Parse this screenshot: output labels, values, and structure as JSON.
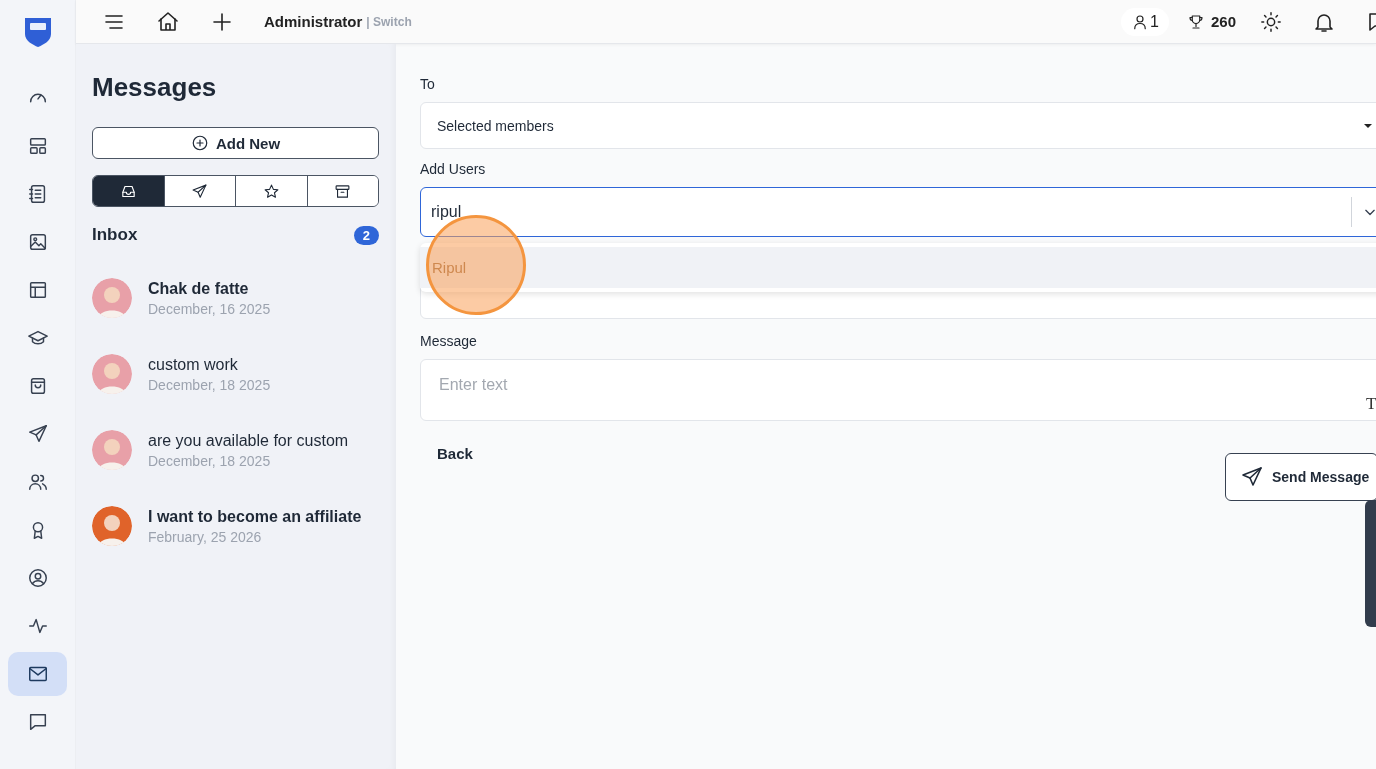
{
  "rail": {
    "items": [
      {
        "kind": "gauge",
        "selected": false
      },
      {
        "kind": "layout",
        "selected": false
      },
      {
        "kind": "notebook",
        "selected": false
      },
      {
        "kind": "image",
        "selected": false
      },
      {
        "kind": "template",
        "selected": false
      },
      {
        "kind": "cap",
        "selected": false
      },
      {
        "kind": "bag",
        "selected": false
      },
      {
        "kind": "send",
        "selected": false
      },
      {
        "kind": "users",
        "selected": false
      },
      {
        "kind": "award",
        "selected": false
      },
      {
        "kind": "user",
        "selected": false
      },
      {
        "kind": "activity",
        "selected": false
      },
      {
        "kind": "mail",
        "selected": true
      },
      {
        "kind": "chat",
        "selected": false
      }
    ]
  },
  "topbar": {
    "role": "Administrator",
    "switch": "| Switch",
    "users_count": "1",
    "points": "260"
  },
  "messages_panel": {
    "title": "Messages",
    "add_button": "Add New",
    "tabs": [
      {
        "kind": "inbox",
        "selected": true
      },
      {
        "kind": "send",
        "selected": false
      },
      {
        "kind": "star",
        "selected": false
      },
      {
        "kind": "archive",
        "selected": false
      }
    ],
    "folder": "Inbox",
    "unread_count": "2",
    "threads": [
      {
        "subject": "Chak de fatte",
        "date": "December, 16 2025",
        "unread": true,
        "color": "#e8a0a8"
      },
      {
        "subject": "custom work",
        "date": "December, 18 2025",
        "unread": false,
        "color": "#e8a0a8"
      },
      {
        "subject": "are you available for custom",
        "date": "December, 18 2025",
        "unread": false,
        "color": "#e8a0a8"
      },
      {
        "subject": "I want to become an affiliate",
        "date": "February, 25 2026",
        "unread": true,
        "color": "#e0632a"
      }
    ]
  },
  "form": {
    "to_label": "To",
    "to_value": "Selected members",
    "users_label": "Add Users",
    "users_value": "ripul",
    "options": [
      {
        "label": "Ripul",
        "selected": true
      }
    ],
    "message_label": "Message",
    "message_placeholder": "Enter text",
    "format_glyph": "T",
    "back": "Back",
    "send": "Send Message"
  }
}
